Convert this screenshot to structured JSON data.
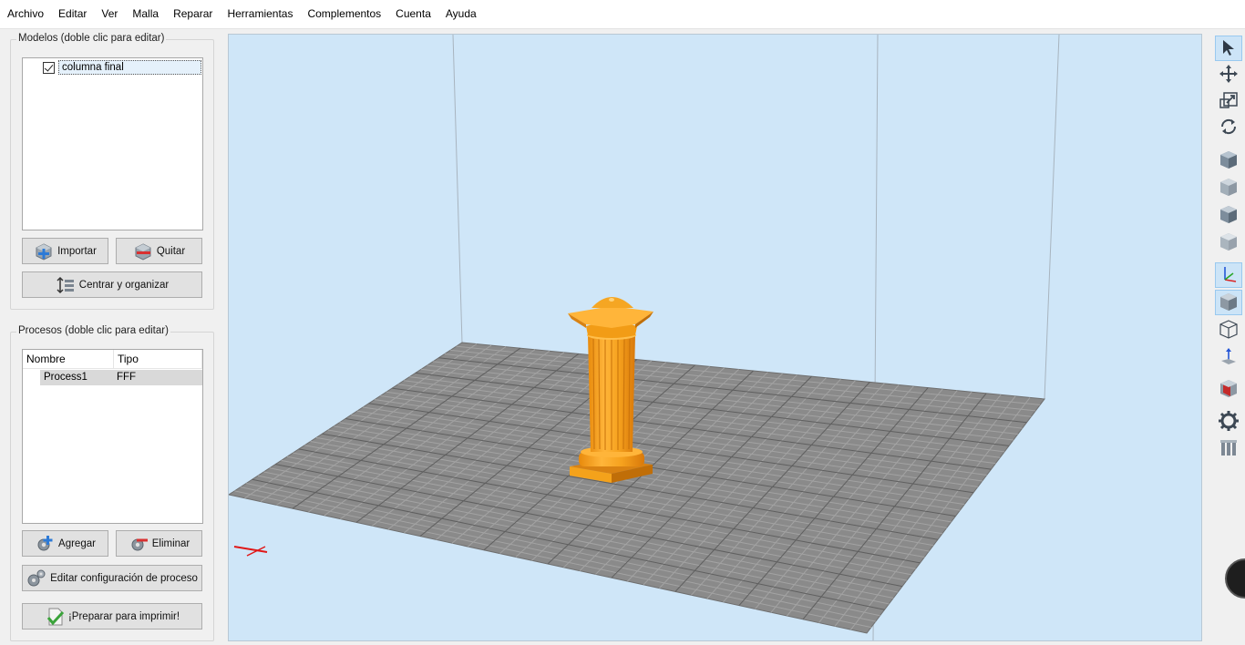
{
  "menu": [
    "Archivo",
    "Editar",
    "Ver",
    "Malla",
    "Reparar",
    "Herramientas",
    "Complementos",
    "Cuenta",
    "Ayuda"
  ],
  "models": {
    "title": "Modelos (doble clic para editar)",
    "items": [
      {
        "name": "columna final",
        "checked": true
      }
    ],
    "import_label": "Importar",
    "remove_label": "Quitar",
    "center_label": "Centrar y organizar"
  },
  "processes": {
    "title": "Procesos (doble clic para editar)",
    "columns": [
      "Nombre",
      "Tipo"
    ],
    "rows": [
      {
        "name": "Process1",
        "type": "FFF"
      }
    ],
    "add_label": "Agregar",
    "delete_label": "Eliminar",
    "edit_label": "Editar configuración de proceso",
    "prepare_label": "¡Preparar para imprimir!"
  },
  "colors": {
    "viewport_bg": "#cfe6f8",
    "bed": "#8a8a8a",
    "model": "#f4a21b",
    "toolbar_active": "#cce4f7"
  },
  "toolbar": [
    {
      "icon": "select-cursor-icon",
      "active": true
    },
    {
      "icon": "move-icon",
      "active": false
    },
    {
      "icon": "scale-icon",
      "active": false
    },
    {
      "icon": "rotate-icon",
      "active": false
    },
    {
      "icon": "view-iso-icon",
      "active": false
    },
    {
      "icon": "view-front-icon",
      "active": false
    },
    {
      "icon": "view-side-icon",
      "active": false
    },
    {
      "icon": "view-top-icon",
      "active": false
    },
    {
      "icon": "axes-icon",
      "active": true
    },
    {
      "icon": "solid-view-icon",
      "active": true
    },
    {
      "icon": "wireframe-view-icon",
      "active": false
    },
    {
      "icon": "z-axis-icon",
      "active": false
    },
    {
      "icon": "cross-section-icon",
      "active": false
    },
    {
      "icon": "settings-gear-icon",
      "active": false
    },
    {
      "icon": "supports-icon",
      "active": false
    }
  ]
}
